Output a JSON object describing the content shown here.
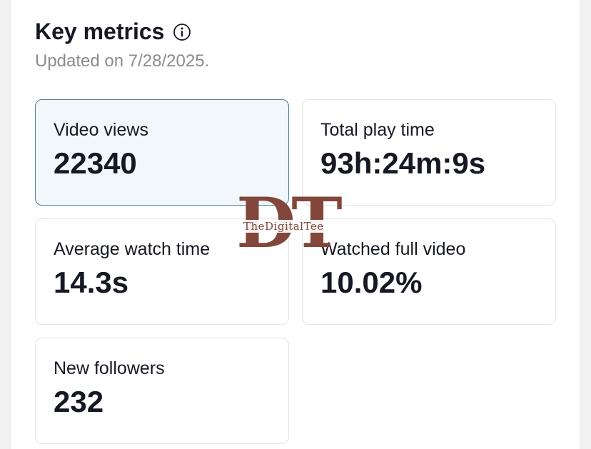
{
  "header": {
    "title": "Key metrics",
    "info_icon": "info-circle-icon",
    "updated": "Updated on 7/28/2025."
  },
  "metrics": [
    {
      "label": "Video views",
      "value": "22340",
      "selected": true
    },
    {
      "label": "Total play time",
      "value": "93h:24m:9s",
      "selected": false
    },
    {
      "label": "Average watch time",
      "value": "14.3s",
      "selected": false
    },
    {
      "label": "Watched full video",
      "value": "10.02%",
      "selected": false
    },
    {
      "label": "New followers",
      "value": "232",
      "selected": false
    }
  ],
  "watermark": {
    "letters": "DT",
    "text": "TheDigitalTee",
    "color": "#82473a"
  },
  "colors": {
    "selected_card_bg": "#f1f7fb",
    "selected_card_border": "#4f7e9a",
    "text_primary": "#161823",
    "text_secondary": "#8a8b91"
  }
}
